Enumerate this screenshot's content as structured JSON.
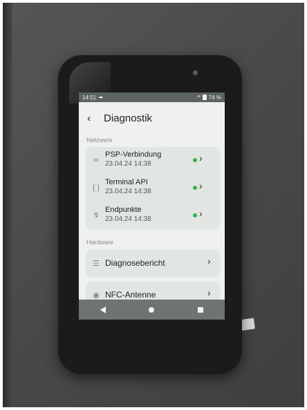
{
  "status": {
    "time": "14:51",
    "battery": "74 %",
    "signal": "·≡"
  },
  "header": {
    "title": "Diagnostik"
  },
  "network": {
    "label": "Netzwerk",
    "items": [
      {
        "name": "PSP-Verbindung",
        "date": "23.04.24 14:38",
        "status_color": "#33b14d"
      },
      {
        "name": "Terminal API",
        "date": "23.04.24 14:38",
        "status_color": "#33b14d"
      },
      {
        "name": "Endpunkte",
        "date": "23.04.24 14:38",
        "status_color": "#33b14d"
      }
    ]
  },
  "hardware": {
    "label": "Hardware",
    "items": [
      {
        "name": "Diagnosebericht"
      },
      {
        "name": "NFC-Antenne"
      }
    ]
  },
  "icons": {
    "link": "link-icon",
    "braces": "braces-icon",
    "endpoint": "endpoint-icon",
    "report": "report-icon",
    "nfc": "nfc-icon"
  }
}
